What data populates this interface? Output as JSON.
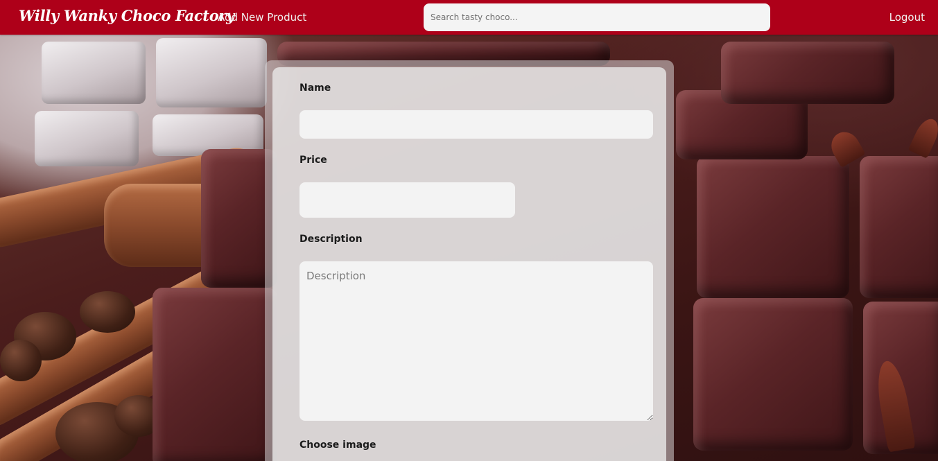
{
  "navbar": {
    "brand": "Willy Wanky Choco Factory",
    "add_product_label": "Add New Product",
    "search_placeholder": "Search tasty choco...",
    "logout_label": "Logout"
  },
  "form": {
    "name_label": "Name",
    "name_value": "",
    "price_label": "Price",
    "price_value": "",
    "description_label": "Description",
    "description_placeholder": "Description",
    "image_label": "Choose image"
  },
  "colors": {
    "navbar": "#ae0019",
    "card": "#e8e6e7",
    "field": "#f3f3f3"
  }
}
